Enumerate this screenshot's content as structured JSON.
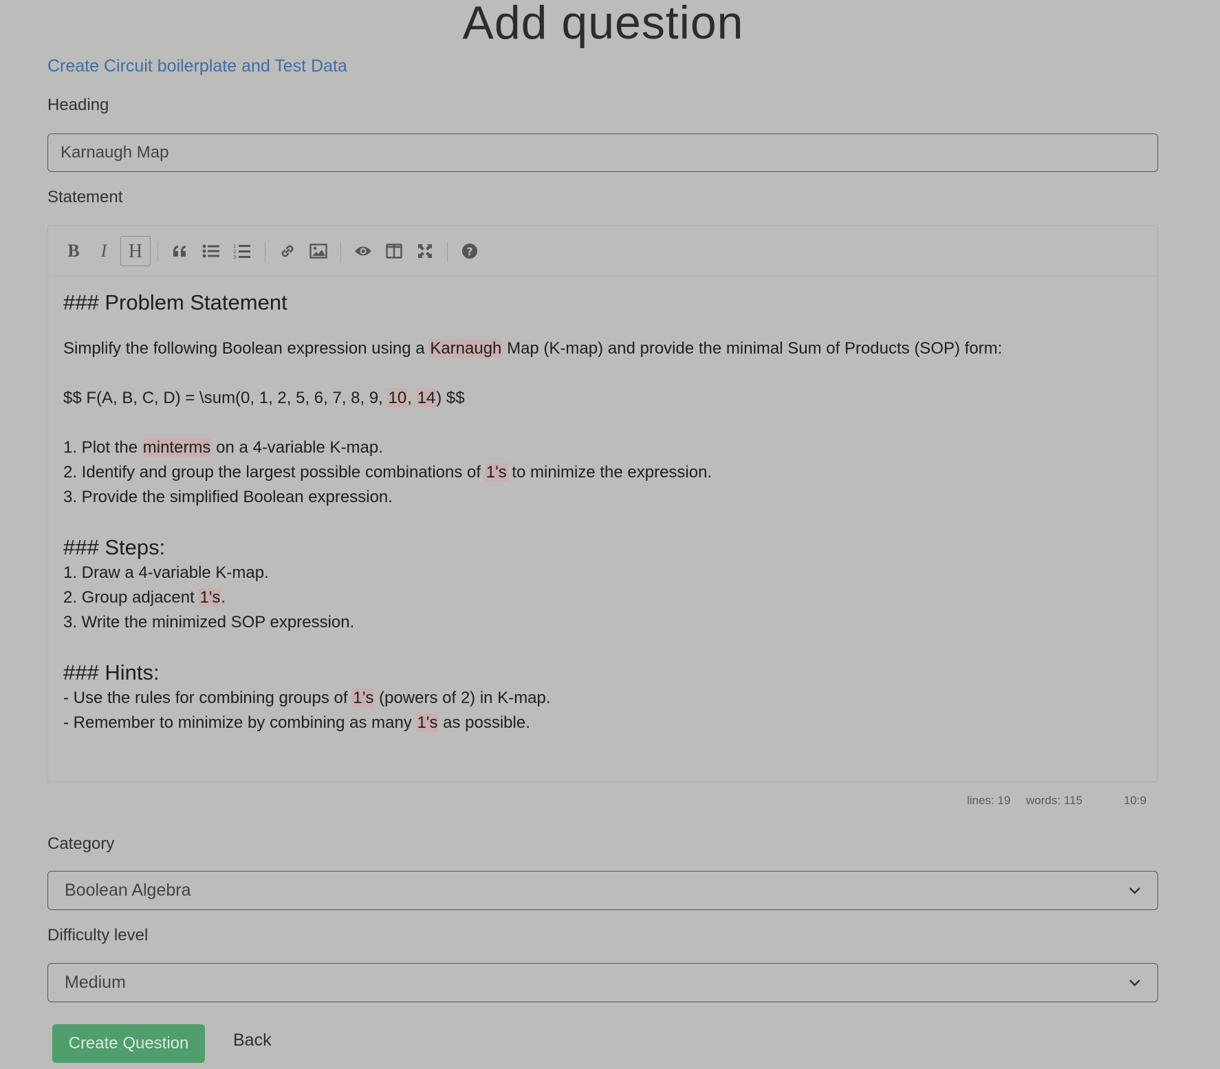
{
  "page": {
    "title": "Add question",
    "boilerplate_link": "Create Circuit boilerplate and Test Data"
  },
  "heading_field": {
    "label": "Heading",
    "value": "Karnaugh Map"
  },
  "statement_field": {
    "label": "Statement",
    "toolbar": [
      {
        "name": "bold",
        "icon": "bold-icon"
      },
      {
        "name": "italic",
        "icon": "italic-icon"
      },
      {
        "name": "heading",
        "icon": "heading-icon",
        "active": true
      },
      {
        "name": "quote",
        "icon": "quote-icon"
      },
      {
        "name": "unordered-list",
        "icon": "unordered-list-icon"
      },
      {
        "name": "ordered-list",
        "icon": "ordered-list-icon"
      },
      {
        "name": "link",
        "icon": "link-icon"
      },
      {
        "name": "image",
        "icon": "image-icon"
      },
      {
        "name": "preview",
        "icon": "eye-icon"
      },
      {
        "name": "side-by-side",
        "icon": "columns-icon"
      },
      {
        "name": "fullscreen",
        "icon": "fullscreen-icon"
      },
      {
        "name": "guide",
        "icon": "question-circle-icon"
      }
    ],
    "content": {
      "h_problem": "### Problem Statement",
      "p1_a": "Simplify the following Boolean expression using a ",
      "p1_hl": "Karnaugh",
      "p1_b": " Map (K-map) and provide the minimal Sum of Products (SOP) form:",
      "eq_a": "$$ F(A, B, C, D) = \\sum(0, 1, 2, 5, 6, 7, 8, 9, ",
      "eq_hl1": "10",
      "eq_b": ", ",
      "eq_hl2": "14",
      "eq_c": ") $$",
      "l1_a": "1. Plot the ",
      "l1_hl": "minterms",
      "l1_b": " on a 4-variable K-map.",
      "l2_a": "2. Identify and group the largest possible combinations of ",
      "l2_hl": "1's",
      "l2_b": " to minimize the expression.",
      "l3": "3. Provide the simplified Boolean expression.",
      "h_steps": "### Steps:",
      "s1": "1. Draw a 4-variable K-map.",
      "s2_a": "2. Group adjacent ",
      "s2_hl": "1's",
      "s2_b": ".",
      "s3": "3. Write the minimized SOP expression.",
      "h_hints": "### Hints:",
      "hint1_a": "- Use the rules for combining groups of ",
      "hint1_hl": "1’s",
      "hint1_b": " (powers of 2) in K-map.",
      "hint2_a": "- Remember to minimize by combining as many ",
      "hint2_hl": "1's",
      "hint2_b": " as possible."
    },
    "status": {
      "lines": "lines: 19",
      "words": "words: 115",
      "cursor": "10:9"
    }
  },
  "category_field": {
    "label": "Category",
    "selected": "Boolean Algebra"
  },
  "difficulty_field": {
    "label": "Difficulty level",
    "selected": "Medium"
  },
  "actions": {
    "create_label": "Create Question",
    "back_label": "Back"
  },
  "colors": {
    "background": "#bcbcbb",
    "link": "#3f6da5",
    "primary_button": "#4f9e6c",
    "highlight": "#cbaeae"
  }
}
